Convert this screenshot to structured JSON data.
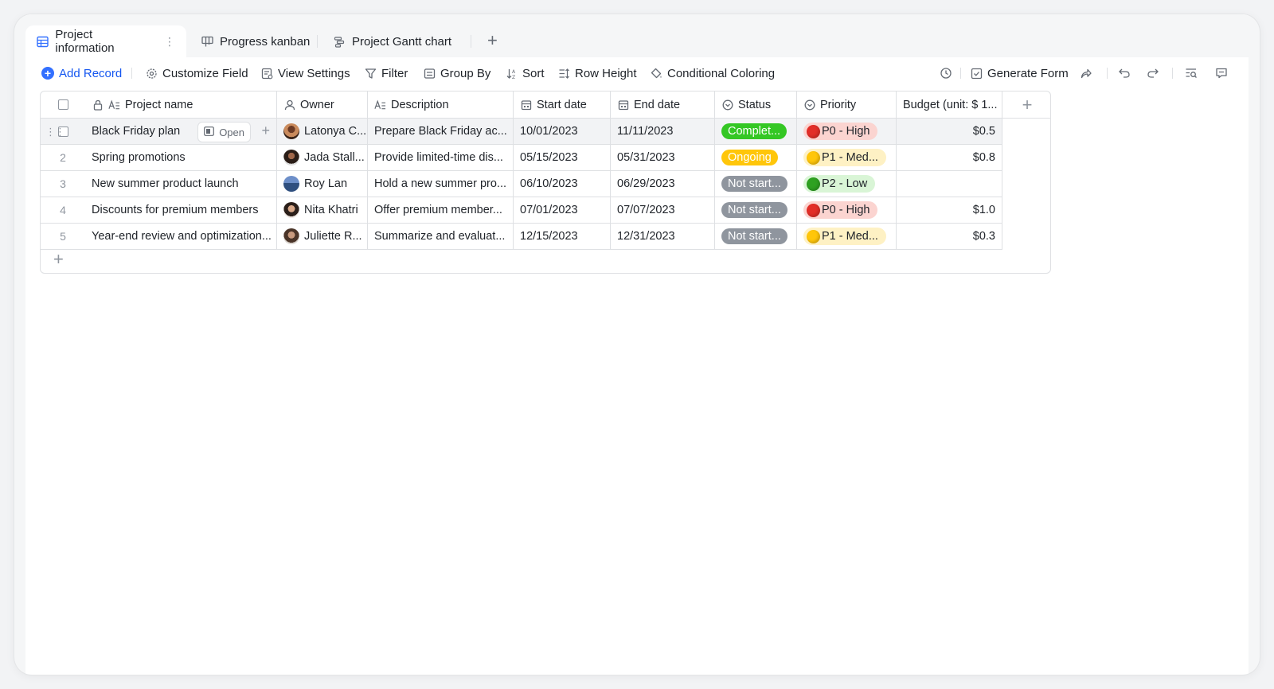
{
  "tabs": [
    {
      "label": "Project information",
      "icon": "grid-table-icon",
      "active": true
    },
    {
      "label": "Progress kanban",
      "icon": "kanban-icon",
      "active": false
    },
    {
      "label": "Project Gantt chart",
      "icon": "gantt-icon",
      "active": false
    }
  ],
  "toolbar": {
    "add_record": "Add Record",
    "customize_field": "Customize Field",
    "view_settings": "View Settings",
    "filter": "Filter",
    "group_by": "Group By",
    "sort": "Sort",
    "row_height": "Row Height",
    "conditional_coloring": "Conditional Coloring",
    "generate_form": "Generate Form"
  },
  "columns": {
    "project_name": "Project name",
    "owner": "Owner",
    "description": "Description",
    "start_date": "Start date",
    "end_date": "End date",
    "status": "Status",
    "priority": "Priority",
    "budget": "Budget (unit: $ 1..."
  },
  "open_label": "Open",
  "rows": [
    {
      "num": "1",
      "name": "Black Friday plan",
      "owner": "Latonya C...",
      "description": "Prepare Black Friday ac...",
      "start": "10/01/2023",
      "end": "11/11/2023",
      "status": "Complet...",
      "priority": "P0 - High",
      "budget": "$0.5"
    },
    {
      "num": "2",
      "name": "Spring promotions",
      "owner": "Jada Stall...",
      "description": "Provide limited-time dis...",
      "start": "05/15/2023",
      "end": "05/31/2023",
      "status": "Ongoing",
      "priority": "P1 - Med...",
      "budget": "$0.8"
    },
    {
      "num": "3",
      "name": "New summer product launch",
      "owner": "Roy Lan",
      "description": "Hold a new summer pro...",
      "start": "06/10/2023",
      "end": "06/29/2023",
      "status": "Not start...",
      "priority": "P2 - Low",
      "budget": ""
    },
    {
      "num": "4",
      "name": "Discounts for premium members",
      "owner": "Nita Khatri",
      "description": "Offer premium member...",
      "start": "07/01/2023",
      "end": "07/07/2023",
      "status": "Not start...",
      "priority": "P0 - High",
      "budget": "$1.0"
    },
    {
      "num": "5",
      "name": "Year-end review and optimization...",
      "owner": "Juliette R...",
      "description": "Summarize and evaluat...",
      "start": "12/15/2023",
      "end": "12/31/2023",
      "status": "Not start...",
      "priority": "P1 - Med...",
      "budget": "$0.3"
    }
  ],
  "colors": {
    "accent": "#3370ff",
    "status_complete": "#34c724",
    "status_ongoing": "#ffc60a",
    "status_not_started": "#8f959e",
    "prio_high_bg": "#fbd4d0",
    "prio_high_dot": "#e22e28",
    "prio_med_bg": "#fef1c4",
    "prio_med_dot": "#ffc60a",
    "prio_low_bg": "#d9f5d6",
    "prio_low_dot": "#2ea121"
  }
}
